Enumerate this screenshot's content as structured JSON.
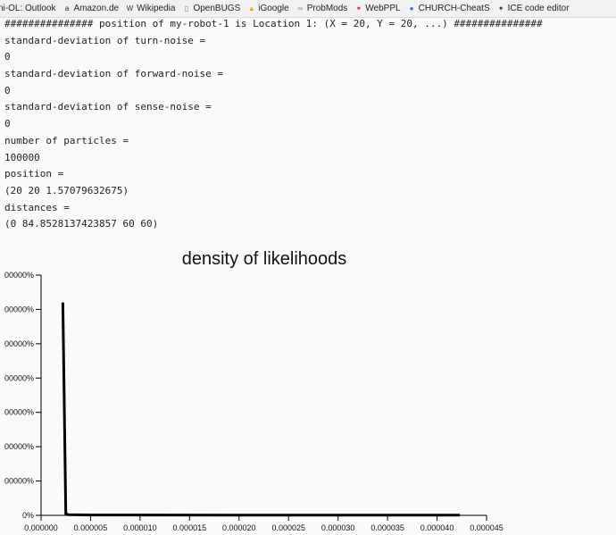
{
  "bookmarks": [
    {
      "label": "ni-OL: Outlook",
      "icon": "outlook-icon"
    },
    {
      "label": "Amazon.de",
      "icon": "amazon-icon",
      "glyph": "a",
      "color": "#222"
    },
    {
      "label": "Wikipedia",
      "icon": "wikipedia-icon",
      "glyph": "W",
      "color": "#333"
    },
    {
      "label": "OpenBUGS",
      "icon": "page-icon",
      "glyph": "▯",
      "color": "#777"
    },
    {
      "label": "iGoogle",
      "icon": "igoogle-icon",
      "glyph": "▲",
      "color": "#e5a32b"
    },
    {
      "label": "ProbMods",
      "icon": "probmods-icon",
      "glyph": "∞",
      "color": "#6b8f3a"
    },
    {
      "label": "WebPPL",
      "icon": "webppl-icon",
      "glyph": "✶",
      "color": "#c2185b"
    },
    {
      "label": "CHURCH-CheatS",
      "icon": "church-icon",
      "glyph": "●",
      "color": "#2e6db4"
    },
    {
      "label": "ICE code editor",
      "icon": "ice-icon",
      "glyph": "✦",
      "color": "#333"
    }
  ],
  "output_lines": [
    "############### position of my-robot-1 is Location 1: (X = 20, Y = 20, ...) ###############",
    "standard-deviation of turn-noise =",
    "0",
    "standard-deviation of forward-noise =",
    "0",
    "standard-deviation of sense-noise =",
    "0",
    "number of particles =",
    "100000",
    "position =",
    "(20 20 1.57079632675)",
    "distances =",
    "(0 84.8528137423857 60 60)"
  ],
  "chart_data": {
    "type": "line",
    "title": "density of likelihoods",
    "x_ticks": [
      "0.000000",
      "0.000005",
      "0.000010",
      "0.000015",
      "0.000020",
      "0.000025",
      "0.000030",
      "0.000035",
      "0.000040",
      "0.000045"
    ],
    "y_ticks": [
      "0%",
      "00000%",
      "00000%",
      "00000%",
      "00000%",
      "00000%",
      "00000%",
      "00000%"
    ],
    "xlim": [
      0,
      4.5e-05
    ],
    "ylim": [
      0,
      7
    ],
    "series": [
      {
        "x": [
          2.2e-06,
          2.5e-06,
          2.7e-06,
          5e-06,
          1e-05,
          2e-05,
          3e-05,
          4e-05,
          4.23e-05
        ],
        "y": [
          6.2,
          0.05,
          0.02,
          0.01,
          0.01,
          0.005,
          0.005,
          0.005,
          0.005
        ]
      }
    ],
    "line_color": "#000000"
  }
}
